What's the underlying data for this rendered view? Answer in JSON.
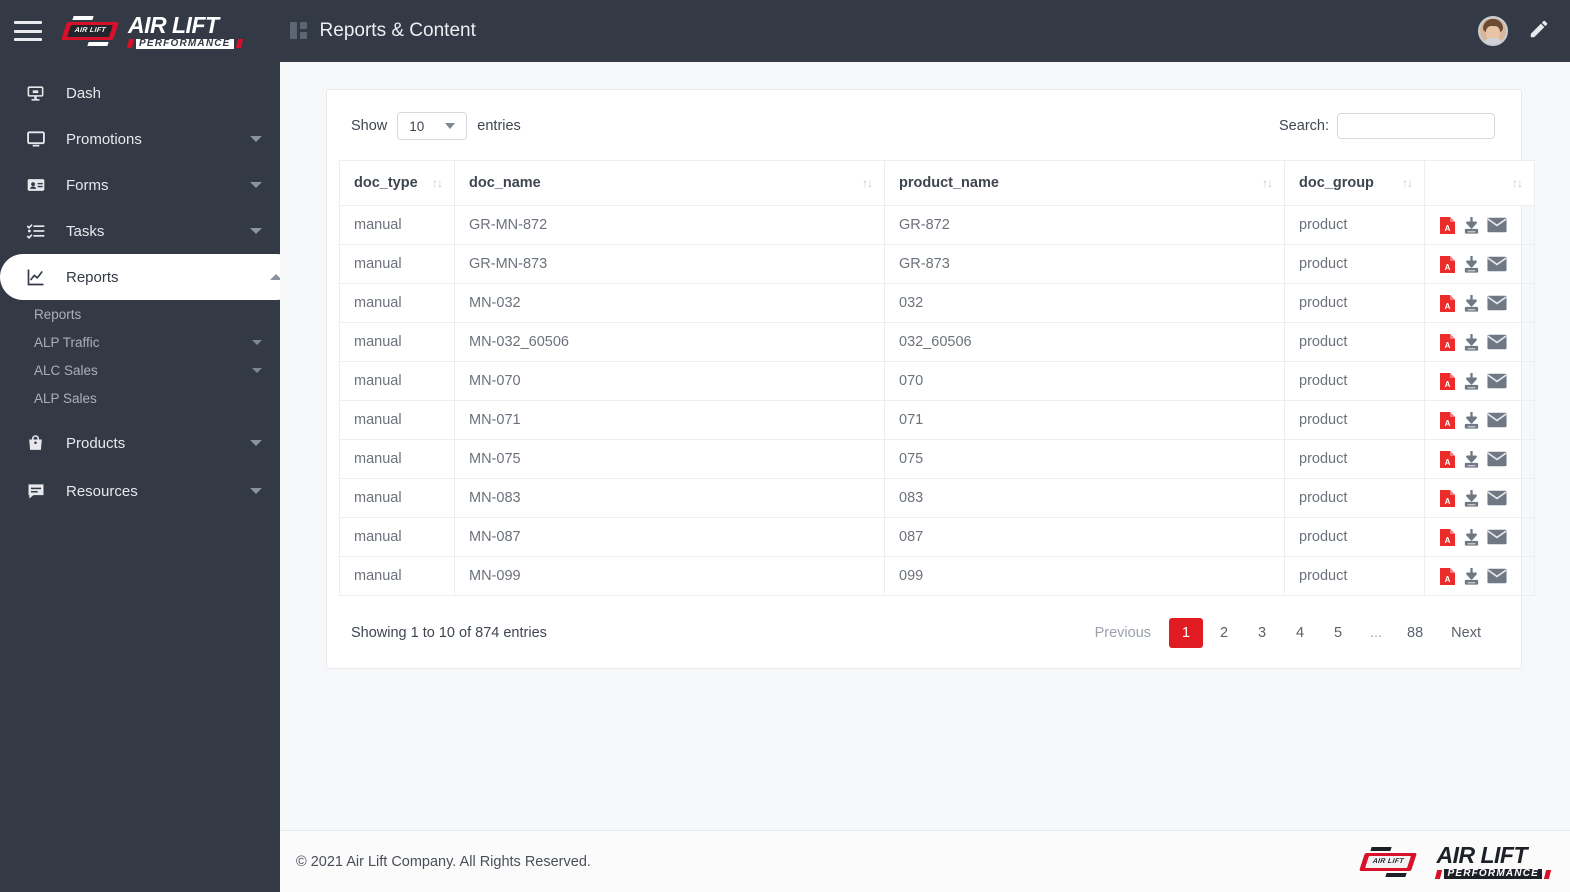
{
  "brand": {
    "shield_text": "AIR LIFT",
    "wordmark_line1": "AIR LIFT",
    "wordmark_line2": "PERFORMANCE"
  },
  "topbar": {
    "menu_icon": "hamburger-icon",
    "page_icon": "grid-icon",
    "title": "Reports & Content",
    "avatar_icon": "user-avatar",
    "edit_icon": "pencil-icon"
  },
  "sidebar": {
    "items": [
      {
        "label": "Dash",
        "icon": "desktop-icon",
        "caret": false,
        "active": false
      },
      {
        "label": "Promotions",
        "icon": "monitor-icon",
        "caret": true,
        "active": false
      },
      {
        "label": "Forms",
        "icon": "id-card-icon",
        "caret": true,
        "active": false
      },
      {
        "label": "Tasks",
        "icon": "checklist-icon",
        "caret": true,
        "active": false
      },
      {
        "label": "Reports",
        "icon": "chart-line-icon",
        "caret": true,
        "active": true
      },
      {
        "label": "Products",
        "icon": "bag-icon",
        "caret": true,
        "active": false
      },
      {
        "label": "Resources",
        "icon": "comment-icon",
        "caret": true,
        "active": false
      }
    ],
    "submenu": [
      {
        "label": "ALP Traffic",
        "caret": true
      },
      {
        "label": "ALC Sales",
        "caret": true
      },
      {
        "label": "ALP Sales",
        "caret": false
      }
    ],
    "submenu_first": {
      "label": "Reports",
      "caret": false
    }
  },
  "datatable": {
    "show_label": "Show",
    "entries_label": "entries",
    "page_length": "10",
    "search_label": "Search:",
    "search_value": "",
    "search_placeholder": "",
    "sort_icon": "↑↓",
    "columns": [
      {
        "key": "doc_type",
        "label": "doc_type"
      },
      {
        "key": "doc_name",
        "label": "doc_name"
      },
      {
        "key": "product_name",
        "label": "product_name"
      },
      {
        "key": "doc_group",
        "label": "doc_group"
      },
      {
        "key": "actions",
        "label": ""
      }
    ],
    "rows": [
      {
        "doc_type": "manual",
        "doc_name": "GR-MN-872",
        "product_name": "GR-872",
        "doc_group": "product"
      },
      {
        "doc_type": "manual",
        "doc_name": "GR-MN-873",
        "product_name": "GR-873",
        "doc_group": "product"
      },
      {
        "doc_type": "manual",
        "doc_name": "MN-032",
        "product_name": "032",
        "doc_group": "product"
      },
      {
        "doc_type": "manual",
        "doc_name": "MN-032_60506",
        "product_name": "032_60506",
        "doc_group": "product"
      },
      {
        "doc_type": "manual",
        "doc_name": "MN-070",
        "product_name": "070",
        "doc_group": "product"
      },
      {
        "doc_type": "manual",
        "doc_name": "MN-071",
        "product_name": "071",
        "doc_group": "product"
      },
      {
        "doc_type": "manual",
        "doc_name": "MN-075",
        "product_name": "075",
        "doc_group": "product"
      },
      {
        "doc_type": "manual",
        "doc_name": "MN-083",
        "product_name": "083",
        "doc_group": "product"
      },
      {
        "doc_type": "manual",
        "doc_name": "MN-087",
        "product_name": "087",
        "doc_group": "product"
      },
      {
        "doc_type": "manual",
        "doc_name": "MN-099",
        "product_name": "099",
        "doc_group": "product"
      }
    ],
    "row_actions": [
      "pdf-icon",
      "download-icon",
      "email-icon"
    ],
    "info": "Showing 1 to 10 of 874 entries",
    "pagination": {
      "previous": "Previous",
      "next": "Next",
      "pages": [
        "1",
        "2",
        "3",
        "4",
        "5",
        "...",
        "88"
      ],
      "current": "1"
    }
  },
  "footer": {
    "copyright": "© 2021 Air Lift Company. All Rights Reserved."
  },
  "colors": {
    "sidebar_bg": "#333a45",
    "accent_red": "#e01b22",
    "brand_red": "#d8102a",
    "page_bg": "#f7f8fa",
    "card_bg": "#ffffff",
    "text_muted": "#6c727b"
  }
}
